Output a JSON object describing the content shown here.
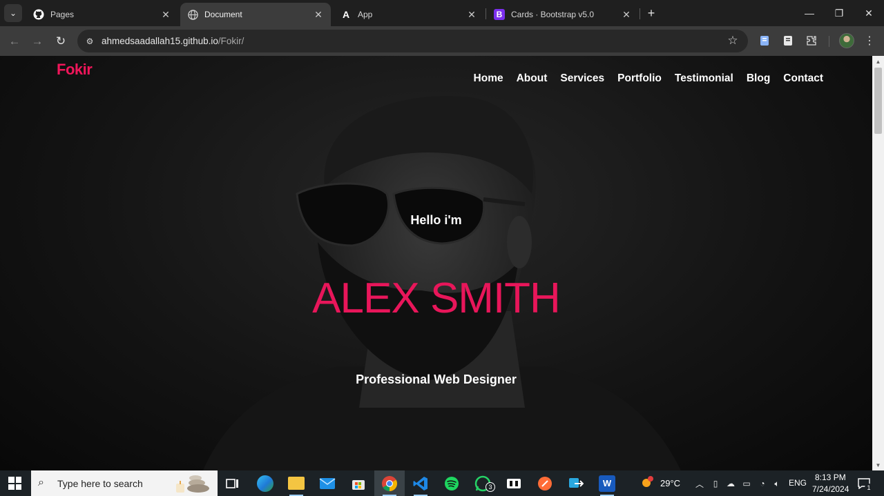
{
  "browser": {
    "tabs": [
      {
        "label": "Pages",
        "icon": "github-icon"
      },
      {
        "label": "Document",
        "icon": "globe-icon",
        "active": true
      },
      {
        "label": "App",
        "icon": "letter-a-icon"
      },
      {
        "label": "Cards · Bootstrap v5.0",
        "icon": "bootstrap-icon",
        "favicon_text": "B"
      }
    ],
    "url_host": "ahmedsaadallah15.github.io",
    "url_path": "/Fokir/"
  },
  "site": {
    "logo": "Fokir",
    "nav": [
      "Home",
      "About",
      "Services",
      "Portfolio",
      "Testimonial",
      "Blog",
      "Contact"
    ],
    "hero": {
      "greeting": "Hello i'm",
      "name": "ALEX SMITH",
      "role": "Professional Web Designer"
    },
    "accent_color": "#e8165a"
  },
  "taskbar": {
    "search_placeholder": "Type here to search",
    "weather": "29°C",
    "language": "ENG",
    "time": "8:13 PM",
    "date": "7/24/2024",
    "whatsapp_badge": "3",
    "notification_count": "1"
  }
}
